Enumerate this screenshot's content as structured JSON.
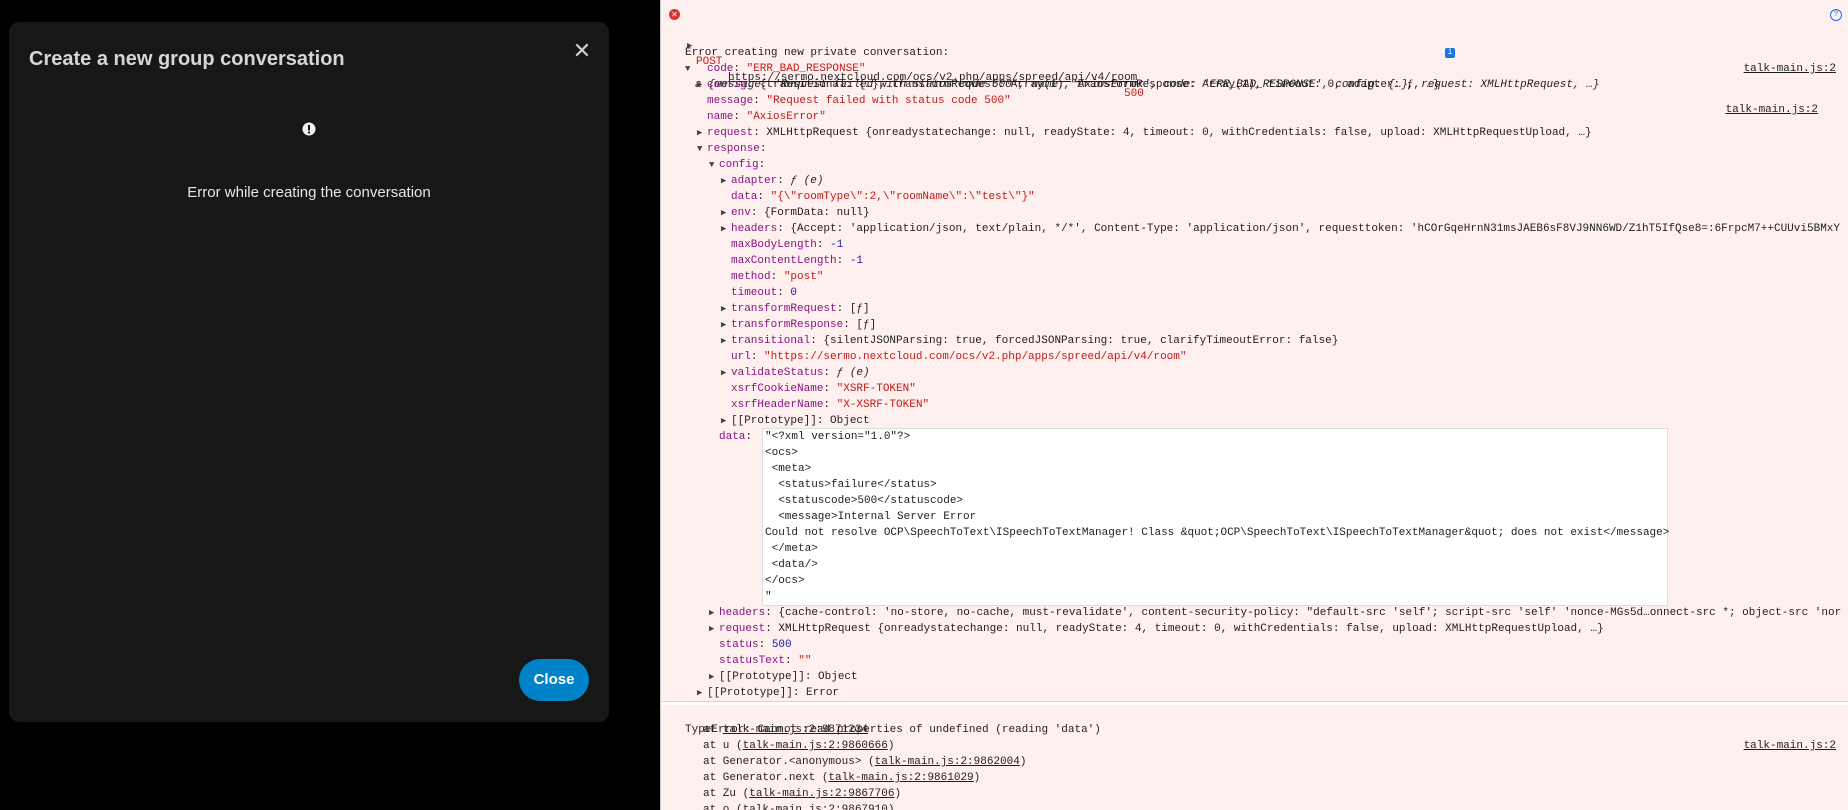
{
  "modal": {
    "title": "Create a new group conversation",
    "close_icon": "✕",
    "error_message": "Error while creating the conversation",
    "close_button": "Close",
    "accent_color": "#0082c9"
  },
  "console": {
    "post_line": {
      "method": "POST",
      "url": "https://sermo.nextcloud.com/ocs/v2.php/apps/spreed/api/v4/room",
      "status": "500",
      "source": "talk-main.js:2"
    },
    "log_title": "Error creating new private conversation:",
    "log_source": "talk-main.js:2",
    "object_summary": "a {message: 'Request failed with status code 500', name: 'AxiosError', code: 'ERR_BAD_RESPONSE', config: {…}, request: XMLHttpRequest, …}",
    "props": {
      "code": "\"ERR_BAD_RESPONSE\"",
      "config_summary": "{transitional: {…}, transformRequest: Array(1), transformResponse: Array(1), timeout: 0, adapter: ƒ, …}",
      "message": "\"Request failed with status code 500\"",
      "name": "\"AxiosError\"",
      "request_summary": "XMLHttpRequest {onreadystatechange: null, readyState: 4, timeout: 0, withCredentials: false, upload: XMLHttpRequestUpload, …}"
    },
    "response_config": {
      "adapter": "ƒ (e)",
      "data": "\"{\\\"roomType\\\":2,\\\"roomName\\\":\\\"test\\\"}\"",
      "env": "{FormData: null}",
      "headers": "{Accept: 'application/json, text/plain, */*', Content-Type: 'application/json', requesttoken: 'hCOrGqeHrnN31msJAEB6sF8VJ9NN6WD/Z1hT5IfQse8=:6FrpcM7++CUUvi5BMxY",
      "maxBodyLength": "-1",
      "maxContentLength": "-1",
      "method": "\"post\"",
      "timeout": "0",
      "transformRequest": "[ƒ]",
      "transformResponse": "[ƒ]",
      "transitional": "{silentJSONParsing: true, forcedJSONParsing: true, clarifyTimeoutError: false}",
      "url": "\"https://sermo.nextcloud.com/ocs/v2.php/apps/spreed/api/v4/room\"",
      "validateStatus": "ƒ (e)",
      "xsrfCookieName": "\"XSRF-TOKEN\"",
      "xsrfHeaderName": "\"X-XSRF-TOKEN\"",
      "prototype": "Object"
    },
    "xml_lines": [
      "\"<?xml version=\"1.0\"?>",
      "<ocs>",
      " <meta>",
      "  <status>failure</status>",
      "  <statuscode>500</statuscode>",
      "  <message>Internal Server Error",
      "Could not resolve OCP\\SpeechToText\\ISpeechToTextManager! Class &quot;OCP\\SpeechToText\\ISpeechToTextManager&quot; does not exist</message>",
      " </meta>",
      " <data/>",
      "</ocs>",
      "\""
    ],
    "response_rest": {
      "headers": "{cache-control: 'no-store, no-cache, must-revalidate', content-security-policy: \"default-src 'self'; script-src 'self' 'nonce-MGs5d…onnect-src *; object-src 'nor",
      "request": "XMLHttpRequest {onreadystatechange: null, readyState: 4, timeout: 0, withCredentials: false, upload: XMLHttpRequestUpload, …}",
      "status": "500",
      "statusText": "\"\"",
      "prototype": "Object"
    },
    "outer_prototype": "Error",
    "type_error": "TypeError: Cannot read properties of undefined (reading 'data')",
    "type_error_source": "talk-main.js:2",
    "stack": [
      {
        "fn": "at ",
        "loc": "talk-main.js:2:9871234",
        "paren": false
      },
      {
        "fn": "at u (",
        "loc": "talk-main.js:2:9860666",
        "paren": true
      },
      {
        "fn": "at Generator.<anonymous> (",
        "loc": "talk-main.js:2:9862004",
        "paren": true
      },
      {
        "fn": "at Generator.next (",
        "loc": "talk-main.js:2:9861029",
        "paren": true
      },
      {
        "fn": "at Zu (",
        "loc": "talk-main.js:2:9867706",
        "paren": true
      },
      {
        "fn": "at o (",
        "loc": "talk-main.js:2:9867910",
        "paren": true
      }
    ]
  }
}
